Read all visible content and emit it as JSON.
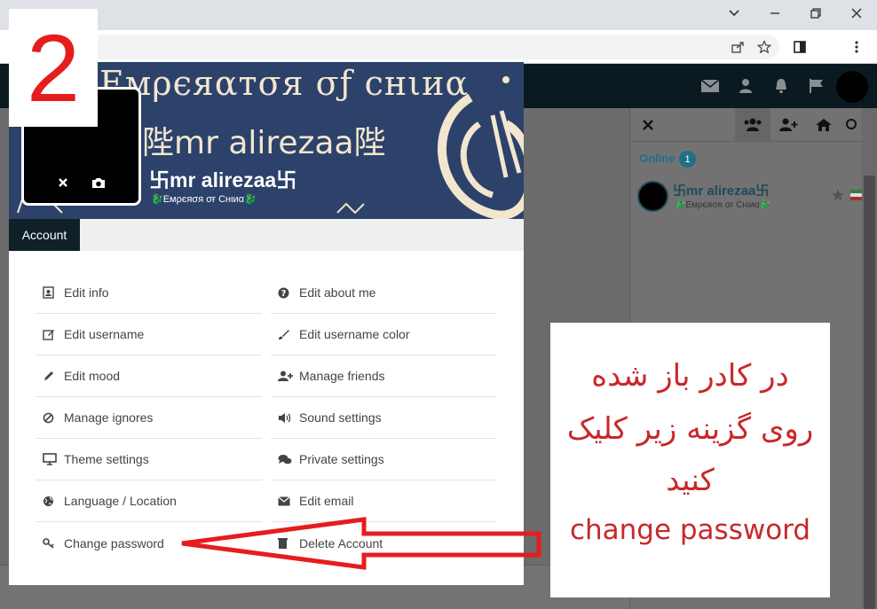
{
  "step": {
    "number": "2"
  },
  "profile": {
    "cover_title": "Eмρєяαтσя σƒ cнιиα",
    "cover_name": "陛mr alirezaa陛",
    "name": "卐mr alirezaa卐",
    "mood": "🐉Eмρєяσя σғ Cнιиα🐉"
  },
  "tabs": [
    {
      "label": "Account"
    }
  ],
  "menu": {
    "left": [
      {
        "label": "Edit info",
        "icon": "contact-card-icon"
      },
      {
        "label": "Edit username",
        "icon": "edit-icon"
      },
      {
        "label": "Edit mood",
        "icon": "pencil-icon"
      },
      {
        "label": "Manage ignores",
        "icon": "ban-icon"
      },
      {
        "label": "Theme settings",
        "icon": "monitor-icon"
      },
      {
        "label": "Language / Location",
        "icon": "globe-icon"
      },
      {
        "label": "Change password",
        "icon": "key-icon"
      }
    ],
    "right": [
      {
        "label": "Edit about me",
        "icon": "question-icon"
      },
      {
        "label": "Edit username color",
        "icon": "paint-brush-icon"
      },
      {
        "label": "Manage friends",
        "icon": "user-plus-icon"
      },
      {
        "label": "Sound settings",
        "icon": "volume-icon"
      },
      {
        "label": "Private settings",
        "icon": "chat-icon"
      },
      {
        "label": "Edit email",
        "icon": "envelope-icon"
      },
      {
        "label": "Delete Account",
        "icon": "trash-icon"
      }
    ]
  },
  "sidebar": {
    "online_label": "Online",
    "online_count": "1",
    "user": {
      "name": "卐mr alirezaa卐",
      "mood": "🐉Eмρєяσя σғ Cнιиα🐉"
    }
  },
  "annotation": {
    "line1": "در کادر باز شده",
    "line2": "روی گزینه زیر کلیک",
    "line3": "کنید",
    "english": "change password",
    "color": "#c8282b"
  },
  "colors": {
    "accent": "#1f6f86",
    "header": "#0f2028",
    "cover": "#2c426a"
  }
}
